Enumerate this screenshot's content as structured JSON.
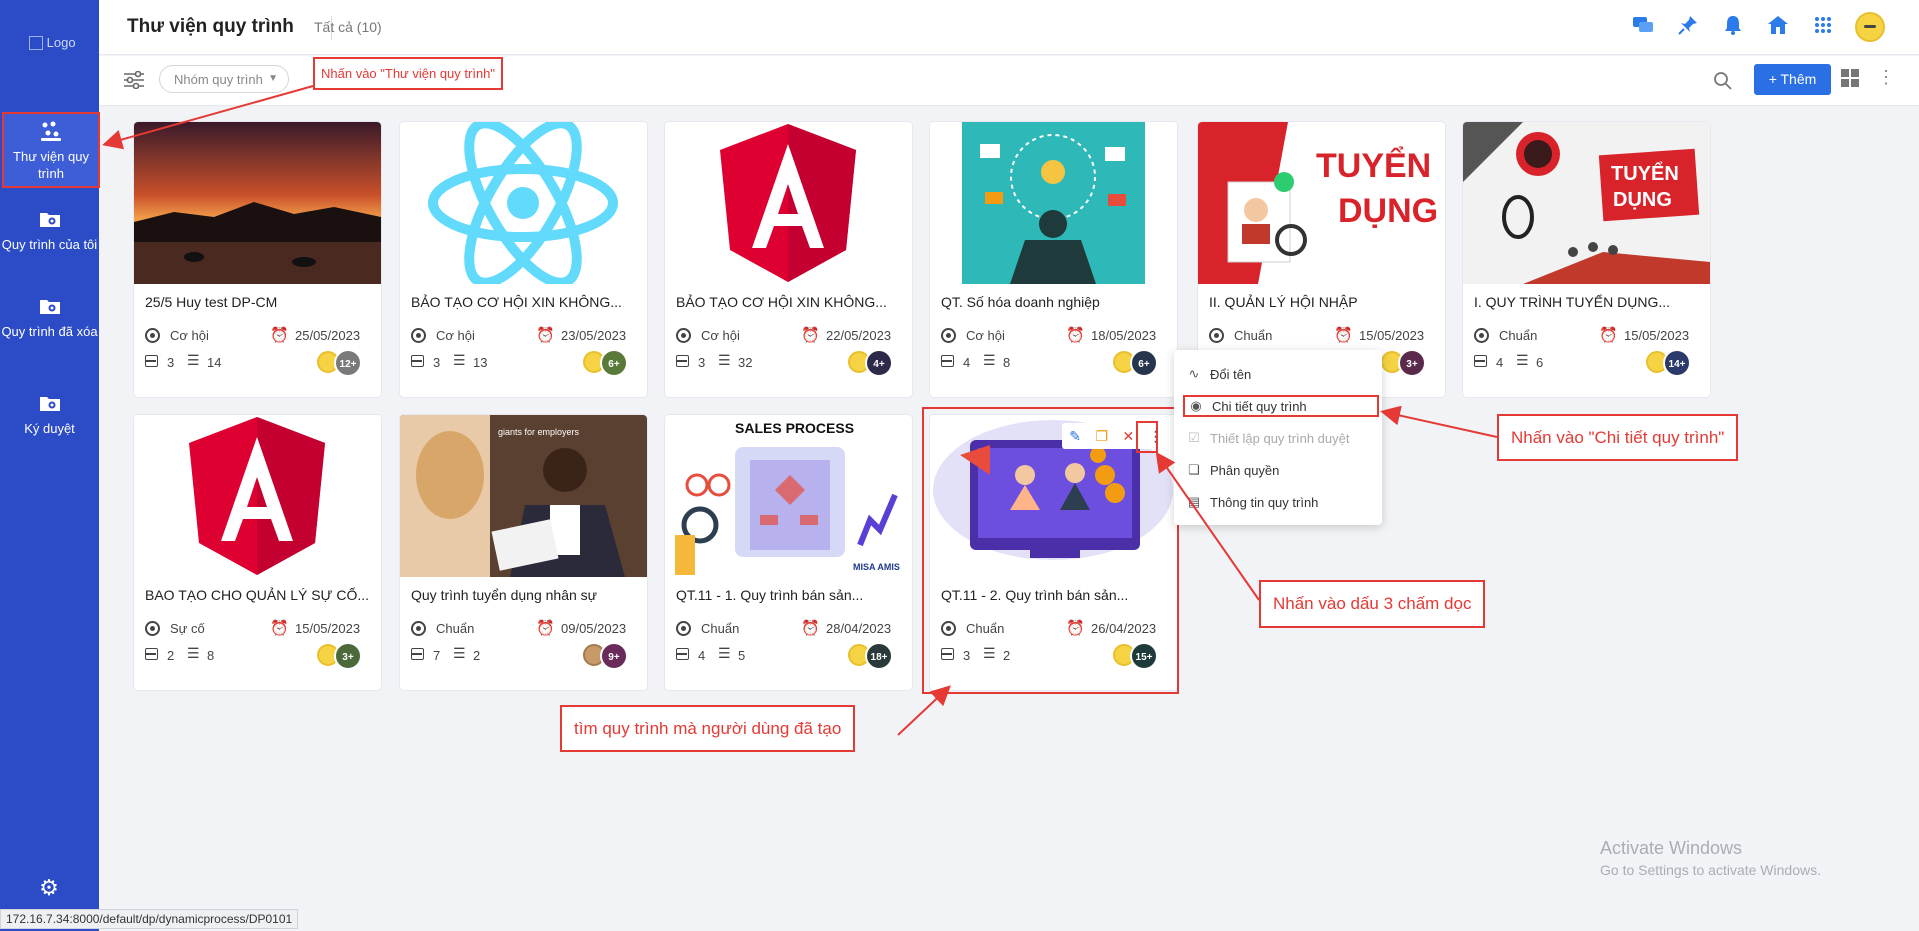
{
  "sidebar": {
    "logo_alt": "Logo",
    "items": [
      {
        "label": "Thư viện quy trình",
        "icon": "library-icon"
      },
      {
        "label": "Quy trình của tôi",
        "icon": "folder-icon"
      },
      {
        "label": "Quy trình đã xóa",
        "icon": "trash-folder-icon"
      },
      {
        "label": "Ký duyệt",
        "icon": "sign-folder-icon"
      }
    ]
  },
  "header": {
    "title": "Thư viện quy trình",
    "count_label": "Tất cả (10)"
  },
  "toolbar": {
    "group_placeholder": "Nhóm quy trình",
    "add_label": "+ Thêm"
  },
  "cards": [
    {
      "title": "25/5 Huy test DP-CM",
      "type": "Cơ hội",
      "date": "25/05/2023",
      "steps": "3",
      "tasks": "14",
      "members": "12+",
      "badge_color": "#7a7a7a"
    },
    {
      "title": "BẢO TẠO CƠ HỘI XIN KHÔNG...",
      "type": "Cơ hội",
      "date": "23/05/2023",
      "steps": "3",
      "tasks": "13",
      "members": "6+",
      "badge_color": "#5a7a3a"
    },
    {
      "title": "BẢO TẠO CƠ HỘI XIN KHÔNG...",
      "type": "Cơ hội",
      "date": "22/05/2023",
      "steps": "3",
      "tasks": "32",
      "members": "4+",
      "badge_color": "#2e2a4a"
    },
    {
      "title": "QT. Số hóa doanh nghiệp",
      "type": "Cơ hội",
      "date": "18/05/2023",
      "steps": "4",
      "tasks": "8",
      "members": "6+",
      "badge_color": "#26344e"
    },
    {
      "title": "II. QUẢN LÝ HỘI NHẬP",
      "type": "Chuẩn",
      "date": "15/05/2023",
      "steps": "4",
      "tasks": "",
      "members": "3+",
      "badge_color": "#5a2a4a"
    },
    {
      "title": "I. QUY TRÌNH TUYỂN DỤNG...",
      "type": "Chuẩn",
      "date": "15/05/2023",
      "steps": "4",
      "tasks": "6",
      "members": "14+",
      "badge_color": "#2a3a6a"
    },
    {
      "title": "BAO TẠO CHO QUẢN LÝ SỰ CỐ...",
      "type": "Sự cố",
      "date": "15/05/2023",
      "steps": "2",
      "tasks": "8",
      "members": "3+",
      "badge_color": "#4a6a3a"
    },
    {
      "title": "Quy trình tuyển dụng nhân sự",
      "type": "Chuẩn",
      "date": "09/05/2023",
      "steps": "7",
      "tasks": "2",
      "members": "9+",
      "badge_color": "#6a2a5a"
    },
    {
      "title": "QT.11 - 1. Quy trình bán sản...",
      "type": "Chuẩn",
      "date": "28/04/2023",
      "steps": "4",
      "tasks": "5",
      "members": "18+",
      "badge_color": "#2a3a3a"
    },
    {
      "title": "QT.11 - 2. Quy trình bán sản...",
      "type": "Chuẩn",
      "date": "26/04/2023",
      "steps": "3",
      "tasks": "2",
      "members": "15+",
      "badge_color": "#1e3a3a"
    }
  ],
  "thumb_texts": {
    "tuyen_dung_1": "TUYỂN",
    "tuyen_dung_2": "DỤNG",
    "sales_process": "SALES PROCESS",
    "misa_amis": "MISA AMIS",
    "giants": "giants for employers"
  },
  "context_menu": [
    {
      "label": "Đổi tên",
      "icon": "rename-icon",
      "disabled": false
    },
    {
      "label": "Chi tiết quy trình",
      "icon": "eye-icon",
      "disabled": false
    },
    {
      "label": "Thiết lập quy trình duyệt",
      "icon": "approval-icon",
      "disabled": true
    },
    {
      "label": "Phân quyền",
      "icon": "permission-icon",
      "disabled": false
    },
    {
      "label": "Thông tin quy trình",
      "icon": "info-icon",
      "disabled": false
    }
  ],
  "annotations": {
    "library": "Nhấn vào \"Thư viện quy trình\"",
    "detail": "Nhấn vào \"Chi tiết quy trình\"",
    "dots": "Nhấn vào dấu 3 chấm dọc",
    "find": "tìm quy trình mà người dùng đã tạo"
  },
  "watermark": {
    "title": "Activate Windows",
    "subtitle": "Go to Settings to activate Windows."
  },
  "status_url": "172.16.7.34:8000/default/dp/dynamicprocess/DP0101",
  "colors": {
    "sidebar": "#2b4bc7",
    "accent": "#2b6fe5",
    "annotation": "#e53935"
  }
}
